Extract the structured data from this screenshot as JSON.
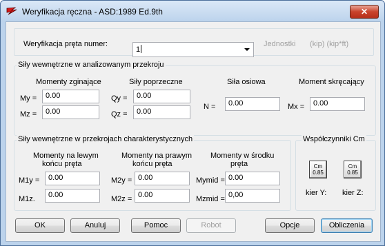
{
  "window": {
    "title": "Weryfikacja ręczna - ASD:1989 Ed.9th",
    "close": "✕"
  },
  "member": {
    "label": "Weryfikacja pręta numer:",
    "value": "1",
    "units_label": "Jednostki",
    "units_value": "(kip) (kip*ft)"
  },
  "section_forces": {
    "title": "Siły wewnętrzne w analizowanym przekroju",
    "bending_header": "Momenty zginające",
    "shear_header": "Siły poprzeczne",
    "axial_header": "Siła osiowa",
    "torsion_header": "Moment skręcający",
    "my_label": "My =",
    "my_value": "0.00",
    "mz_label": "Mz =",
    "mz_value": "0.00",
    "qy_label": "Qy =",
    "qy_value": "0.00",
    "qz_label": "Qz =",
    "qz_value": "0.00",
    "n_label": "N =",
    "n_value": "0.00",
    "mx_label": "Mx =",
    "mx_value": "0.00"
  },
  "characteristic": {
    "title": "Siły wewnętrzne w przekrojach charakterystycznych",
    "left_header_1": "Momenty na lewym",
    "left_header_2": "końcu pręta",
    "right_header_1": "Momenty na prawym",
    "right_header_2": "końcu pręta",
    "mid_header_1": "Momenty w środku",
    "mid_header_2": "pręta",
    "m1y_label": "M1y =",
    "m1y_value": "0.00",
    "m1z_label": "M1z.",
    "m1z_value": "0.00",
    "m2y_label": "M2y =",
    "m2y_value": "0.00",
    "m2z_label": "M2z =",
    "m2z_value": "0.00",
    "mymid_label": "Mymid =",
    "mymid_value": "0.00",
    "mzmid_label": "Mzmid =",
    "mzmid_value": "0,00"
  },
  "cm": {
    "title": "Współczynniki Cm",
    "btn_y_label": "Cm",
    "btn_y_value": "0.85",
    "btn_z_label": "Cm",
    "btn_z_value": "0.85",
    "dir_y": "kier Y:",
    "dir_z": "kier Z:"
  },
  "buttons": {
    "ok": "OK",
    "cancel": "Anuluj",
    "help": "Pomoc",
    "robot": "Robot",
    "options": "Opcje",
    "calculate": "Obliczenia"
  },
  "colors": {
    "title_bg": "#bcd3ec",
    "client_bg": "#f0f0f0",
    "close_red": "#c9432c",
    "disabled_text": "#a0a0a0"
  }
}
